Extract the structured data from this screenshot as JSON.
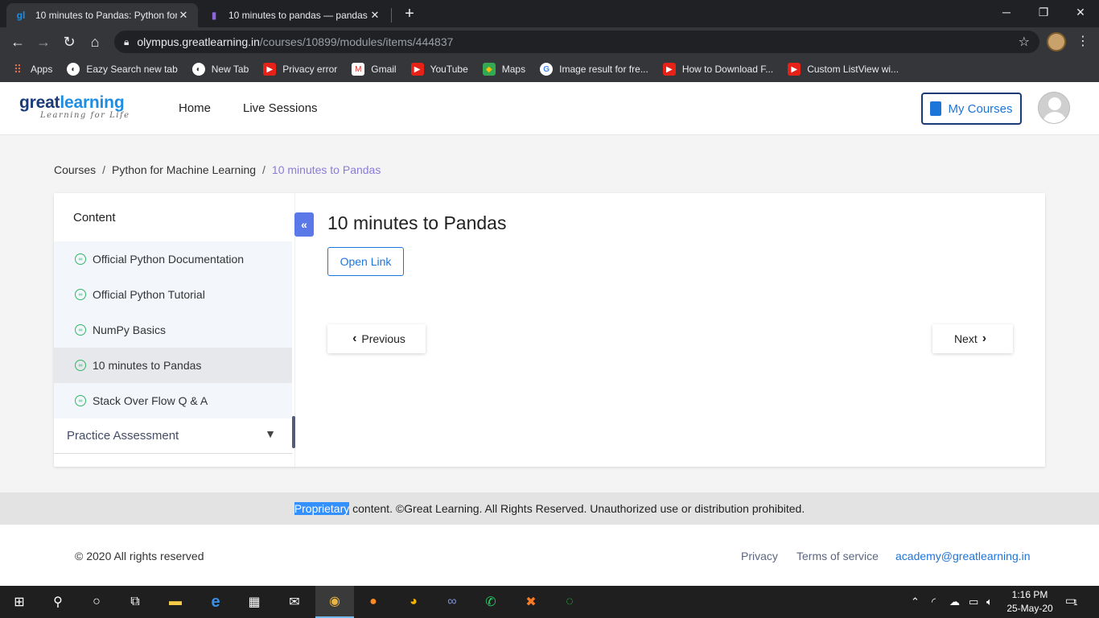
{
  "browser": {
    "tabs": [
      {
        "title": "10 minutes to Pandas: Python for",
        "active": true
      },
      {
        "title": "10 minutes to pandas — pandas",
        "active": false
      }
    ],
    "url_host": "olympus.greatlearning.in",
    "url_path": "/courses/10899/modules/items/444837",
    "bookmarks": [
      "Apps",
      "Eazy Search new tab",
      "New Tab",
      "Privacy error",
      "Gmail",
      "YouTube",
      "Maps",
      "Image result for fre...",
      "How to Download F...",
      "Custom ListView wi..."
    ]
  },
  "header": {
    "logo_main_1": "great",
    "logo_main_2": "learning",
    "logo_tagline": "Learning for Life",
    "nav": [
      "Home",
      "Live Sessions"
    ],
    "my_courses": "My Courses"
  },
  "breadcrumb": [
    "Courses",
    "Python for Machine Learning",
    "10 minutes to Pandas"
  ],
  "sidebar": {
    "heading": "Content",
    "items": [
      {
        "label": "Official Python Documentation",
        "active": false
      },
      {
        "label": "Official Python Tutorial",
        "active": false
      },
      {
        "label": "NumPy Basics",
        "active": false
      },
      {
        "label": "10 minutes to Pandas",
        "active": true
      },
      {
        "label": "Stack Over Flow Q & A",
        "active": false
      }
    ],
    "section": "Practice Assessment"
  },
  "main": {
    "title": "10 minutes to Pandas",
    "open_link": "Open Link",
    "previous": "Previous",
    "next": "Next"
  },
  "notice": {
    "highlighted": "Proprietary",
    "rest": " content. ©Great Learning. All Rights Reserved. Unauthorized use or distribution prohibited."
  },
  "footer": {
    "copyright": "© 2020 All rights reserved",
    "privacy": "Privacy",
    "terms": "Terms of service",
    "email": "academy@greatlearning.in"
  },
  "taskbar": {
    "time": "1:16 PM",
    "date": "25-May-20",
    "notification_count": "1"
  },
  "colors": {
    "accent": "#1d74d9",
    "brand_dark": "#1a3a78",
    "breadcrumb_current": "#8c7bd8",
    "sidebar_button": "#5b78e8"
  }
}
